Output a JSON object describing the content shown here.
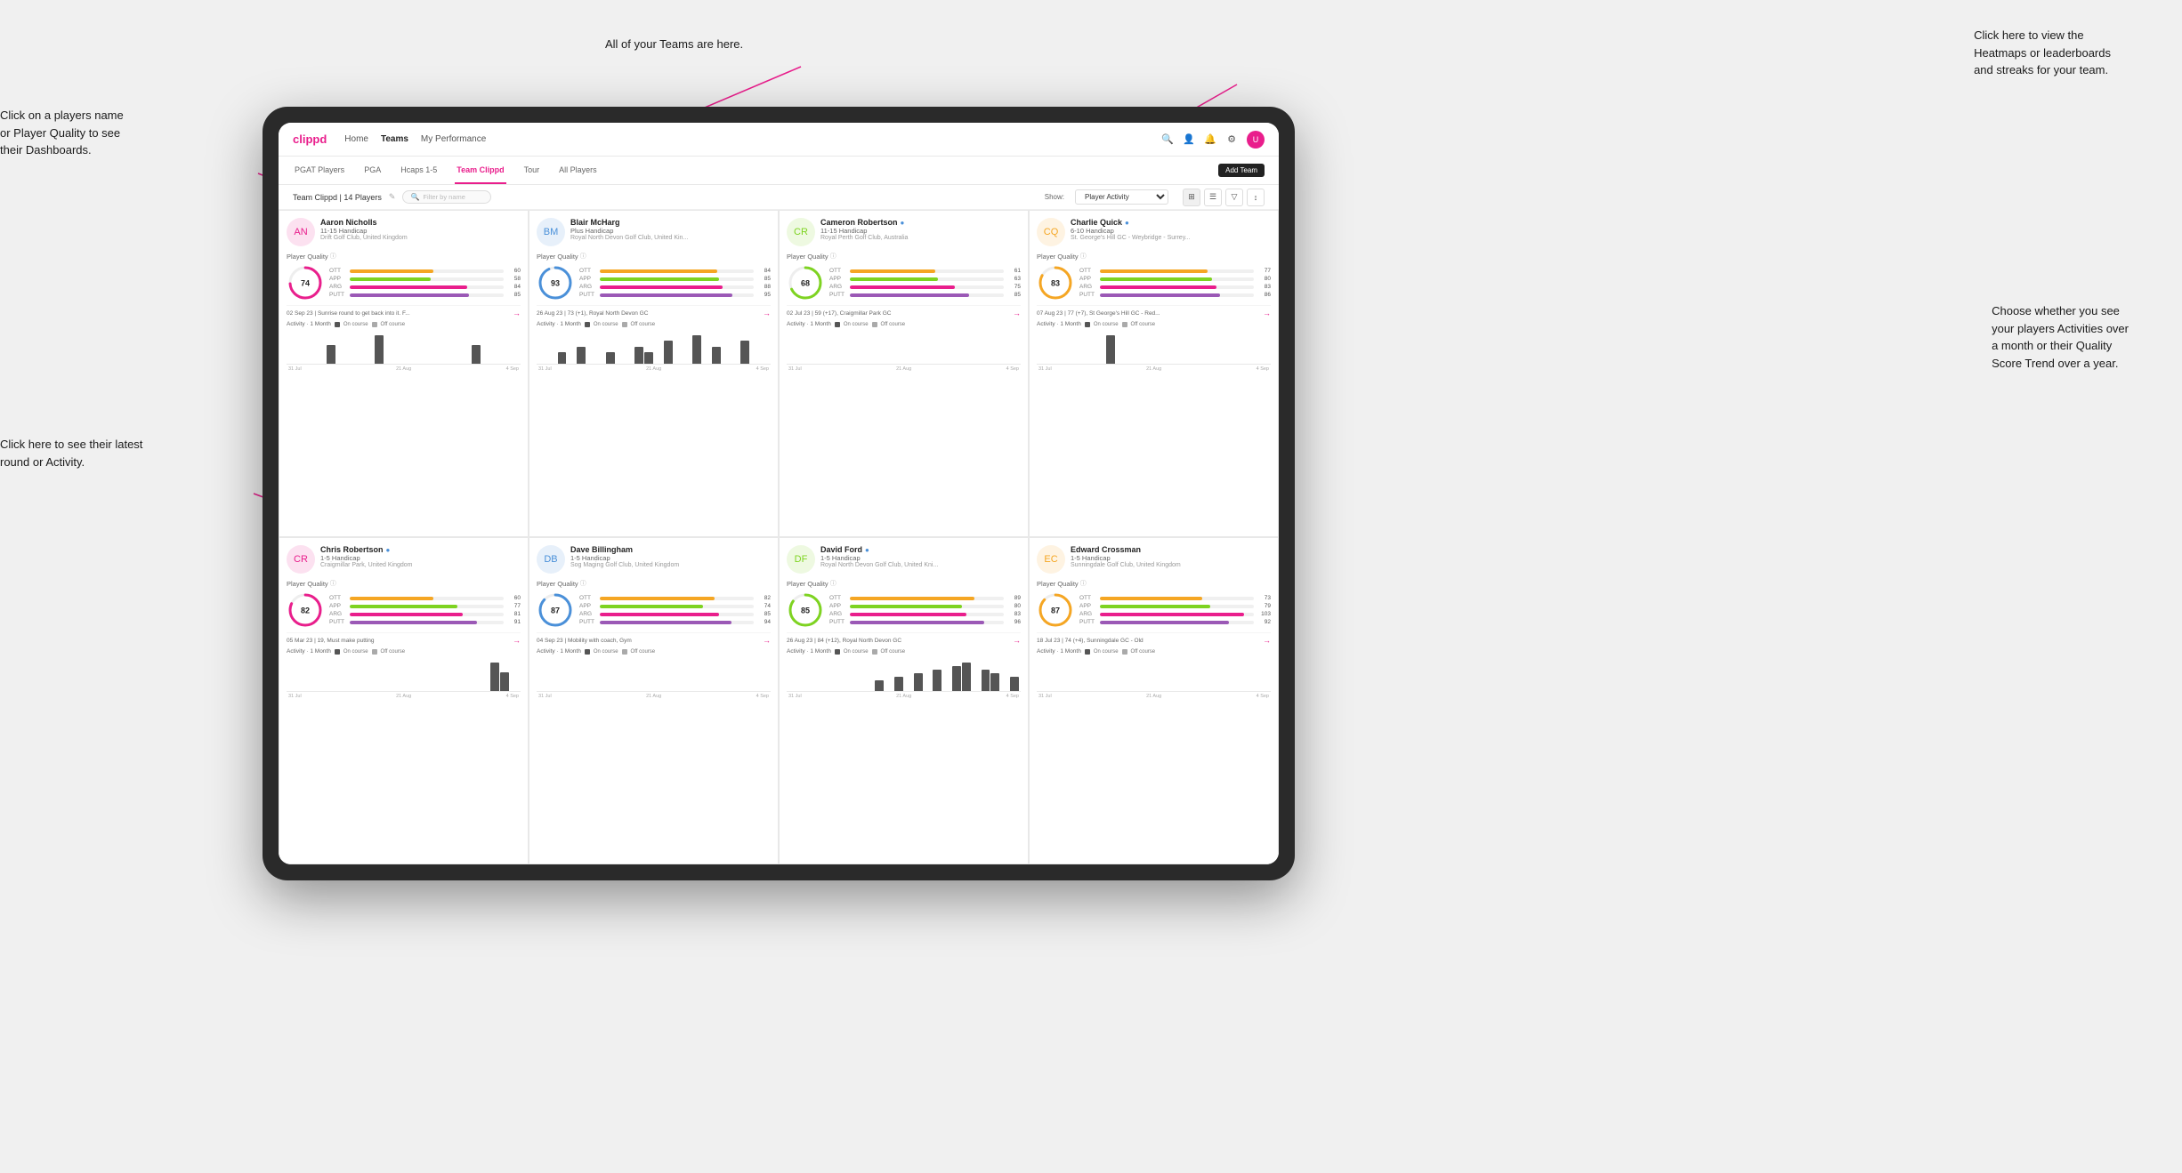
{
  "app": {
    "title": "clippd",
    "nav_links": [
      "Home",
      "Teams",
      "My Performance"
    ],
    "active_nav": "Teams"
  },
  "sub_tabs": [
    "PGAT Players",
    "PGA",
    "Hcaps 1-5",
    "Team Clippd",
    "Tour",
    "All Players"
  ],
  "active_sub_tab": "Team Clippd",
  "add_team_btn": "Add Team",
  "team_header": {
    "name": "Team Clippd | 14 Players",
    "filter_placeholder": "Filter by name",
    "show_label": "Show:",
    "show_value": "Player Activity"
  },
  "players": [
    {
      "name": "Aaron Nicholls",
      "handicap": "11-15 Handicap",
      "club": "Drift Golf Club, United Kingdom",
      "quality": 74,
      "ott": 60,
      "app": 58,
      "arg": 84,
      "putt": 85,
      "latest_round": "02 Sep 23 | Sunrise round to get back into it. F...",
      "bars": [
        0,
        0,
        0,
        0,
        2,
        0,
        0,
        0,
        0,
        3,
        0,
        0,
        0,
        0,
        0,
        0,
        0,
        0,
        0,
        2,
        0,
        0,
        0,
        0
      ],
      "dates": [
        "31 Jul",
        "21 Aug",
        "4 Sep"
      ]
    },
    {
      "name": "Blair McHarg",
      "handicap": "Plus Handicap",
      "club": "Royal North Devon Golf Club, United Kin...",
      "quality": 93,
      "ott": 84,
      "app": 85,
      "arg": 88,
      "putt": 95,
      "latest_round": "26 Aug 23 | 73 (+1), Royal North Devon GC",
      "bars": [
        0,
        0,
        2,
        0,
        3,
        0,
        0,
        2,
        0,
        0,
        3,
        2,
        0,
        4,
        0,
        0,
        5,
        0,
        3,
        0,
        0,
        4,
        0,
        0
      ],
      "dates": [
        "31 Jul",
        "21 Aug",
        "4 Sep"
      ]
    },
    {
      "name": "Cameron Robertson",
      "handicap": "11-15 Handicap",
      "club": "Royal Perth Golf Club, Australia",
      "quality": 68,
      "ott": 61,
      "app": 63,
      "arg": 75,
      "putt": 85,
      "latest_round": "02 Jul 23 | 59 (+17), Craigmillar Park GC",
      "bars": [
        0,
        0,
        0,
        0,
        0,
        0,
        0,
        0,
        0,
        0,
        0,
        0,
        0,
        0,
        0,
        0,
        0,
        0,
        0,
        0,
        0,
        0,
        0,
        0
      ],
      "dates": [
        "31 Jul",
        "21 Aug",
        "4 Sep"
      ],
      "verified": true
    },
    {
      "name": "Charlie Quick",
      "handicap": "6-10 Handicap",
      "club": "St. George's Hill GC - Weybridge - Surrey...",
      "quality": 83,
      "ott": 77,
      "app": 80,
      "arg": 83,
      "putt": 86,
      "latest_round": "07 Aug 23 | 77 (+7), St George's Hill GC - Red...",
      "bars": [
        0,
        0,
        0,
        0,
        0,
        0,
        0,
        2,
        0,
        0,
        0,
        0,
        0,
        0,
        0,
        0,
        0,
        0,
        0,
        0,
        0,
        0,
        0,
        0
      ],
      "dates": [
        "31 Jul",
        "21 Aug",
        "4 Sep"
      ],
      "verified": true
    },
    {
      "name": "Chris Robertson",
      "handicap": "1-5 Handicap",
      "club": "Craigmillar Park, United Kingdom",
      "quality": 82,
      "ott": 60,
      "app": 77,
      "arg": 81,
      "putt": 91,
      "latest_round": "05 Mar 23 | 19, Must make putting",
      "bars": [
        0,
        0,
        0,
        0,
        0,
        0,
        0,
        0,
        0,
        0,
        0,
        0,
        0,
        0,
        0,
        0,
        0,
        0,
        0,
        0,
        0,
        3,
        2,
        0
      ],
      "dates": [
        "31 Jul",
        "21 Aug",
        "4 Sep"
      ],
      "verified": true
    },
    {
      "name": "Dave Billingham",
      "handicap": "1-5 Handicap",
      "club": "Sog Maging Golf Club, United Kingdom",
      "quality": 87,
      "ott": 82,
      "app": 74,
      "arg": 85,
      "putt": 94,
      "latest_round": "04 Sep 23 | Mobility with coach, Gym",
      "bars": [
        0,
        0,
        0,
        0,
        0,
        0,
        0,
        0,
        0,
        0,
        0,
        0,
        0,
        0,
        0,
        0,
        0,
        0,
        0,
        0,
        0,
        0,
        0,
        0
      ],
      "dates": [
        "31 Jul",
        "21 Aug",
        "4 Sep"
      ]
    },
    {
      "name": "David Ford",
      "handicap": "1-5 Handicap",
      "club": "Royal North Devon Golf Club, United Kni...",
      "quality": 85,
      "ott": 89,
      "app": 80,
      "arg": 83,
      "putt": 96,
      "latest_round": "26 Aug 23 | 84 (+12), Royal North Devon GC",
      "bars": [
        0,
        0,
        0,
        0,
        0,
        0,
        0,
        0,
        0,
        3,
        0,
        4,
        0,
        5,
        0,
        6,
        0,
        7,
        8,
        0,
        6,
        5,
        0,
        4
      ],
      "dates": [
        "31 Jul",
        "21 Aug",
        "4 Sep"
      ],
      "verified": true
    },
    {
      "name": "Edward Crossman",
      "handicap": "1-5 Handicap",
      "club": "Sunningdale Golf Club, United Kingdom",
      "quality": 87,
      "ott": 73,
      "app": 79,
      "arg": 103,
      "putt": 92,
      "latest_round": "18 Jul 23 | 74 (+4), Sunningdale GC - Old",
      "bars": [
        0,
        0,
        0,
        0,
        0,
        0,
        0,
        0,
        0,
        0,
        0,
        0,
        0,
        0,
        0,
        0,
        0,
        0,
        0,
        0,
        0,
        0,
        0,
        0
      ],
      "dates": [
        "31 Jul",
        "21 Aug",
        "4 Sep"
      ]
    }
  ],
  "annotations": {
    "teams_annotation": "All of your Teams are here.",
    "heatmaps_annotation": "Click here to view the\nHeatmaps or leaderboards\nand streaks for your team.",
    "player_name_annotation": "Click on a players name\nor Player Quality to see\ntheir Dashboards.",
    "latest_round_annotation": "Click here to see their latest\nround or Activity.",
    "activities_annotation": "Choose whether you see\nyour players Activities over\na month or their Quality\nScore Trend over a year."
  },
  "stat_colors": {
    "ott": "#f5a623",
    "app": "#7ed321",
    "arg": "#e91e8c",
    "putt": "#9b59b6"
  },
  "chart_colors": {
    "on_course": "#555",
    "off_course": "#aaa"
  }
}
